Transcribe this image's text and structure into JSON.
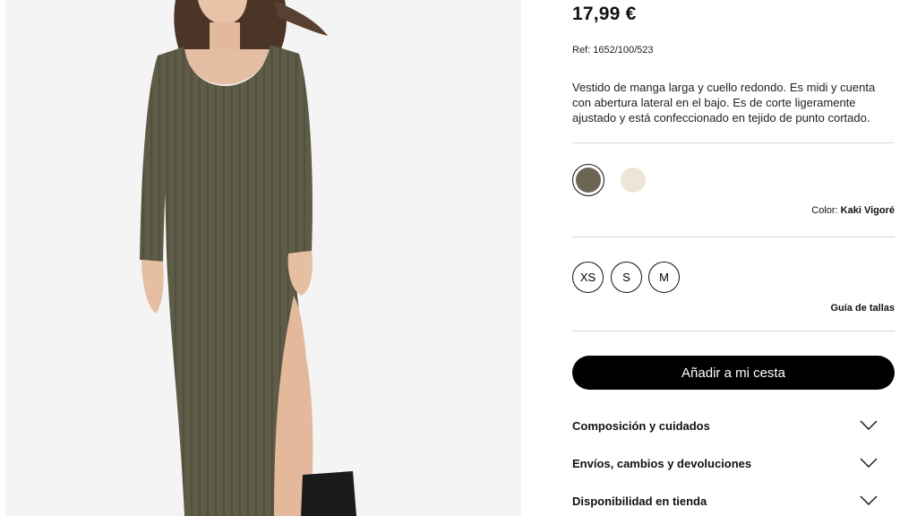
{
  "product": {
    "price": "17,99 €",
    "ref": "Ref: 1652/100/523",
    "description": "Vestido de manga larga y cuello redondo. Es midi y cuenta con abertura lateral en el bajo. Es de corte ligeramente ajustado y está confeccionado en tejido de punto cortado."
  },
  "colors": {
    "swatches": [
      {
        "name": "Kaki Vigoré",
        "hex": "#6b6553",
        "selected": true
      },
      {
        "name": "crudo",
        "hex": "#ede6d6",
        "selected": false
      }
    ],
    "label_prefix": "Color:",
    "selected_name": "Kaki Vigoré"
  },
  "sizes": {
    "options": [
      "XS",
      "S",
      "M"
    ],
    "guide_label": "Guía de tallas"
  },
  "cart": {
    "add_label": "Añadir a mi cesta"
  },
  "accordions": [
    {
      "label": "Composición y cuidados",
      "icon": "chevron-down-icon"
    },
    {
      "label": "Envíos, cambios y devoluciones",
      "icon": "chevron-down-icon"
    },
    {
      "label": "Disponibilidad en tienda",
      "icon": "chevron-down-icon"
    }
  ],
  "theme": {
    "dress": "#5e5b47",
    "button_bg": "#000000",
    "divider": "#d8d8d8"
  }
}
